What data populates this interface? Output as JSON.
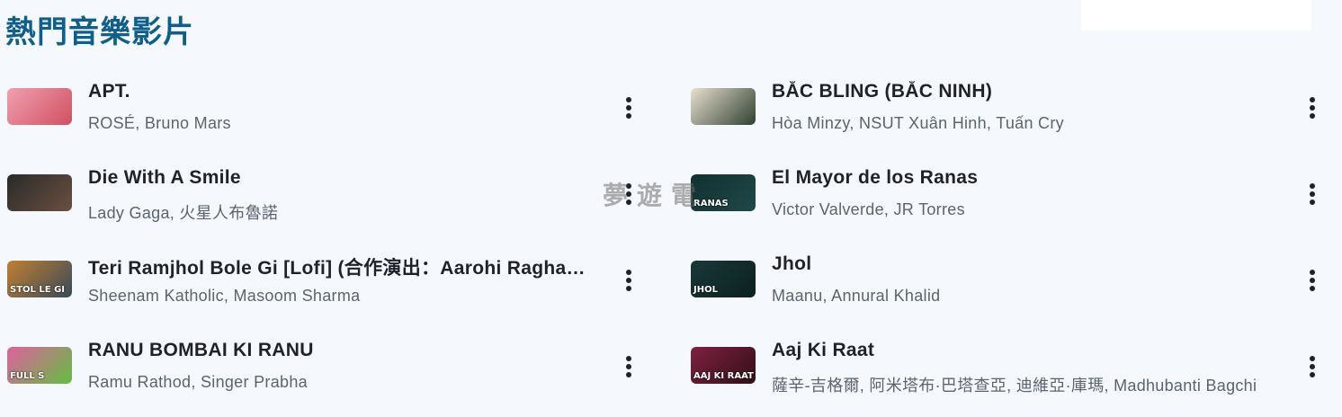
{
  "section": {
    "title": "熱門音樂影片"
  },
  "watermark": "夢遊電",
  "left_column": [
    {
      "title": "APT.",
      "artist": "ROSÉ, Bruno Mars",
      "thumb_text": "",
      "thumb_colors": [
        "#f0a0b0",
        "#d05060"
      ]
    },
    {
      "title": "Die With A Smile",
      "artist": "Lady Gaga, 火星人布魯諾",
      "thumb_text": "",
      "thumb_colors": [
        "#2a2a2a",
        "#6a5040"
      ]
    },
    {
      "title": "Teri Ramjhol Bole Gi [Lofi] (合作演出：Aarohi Raghav…",
      "artist": "Sheenam Katholic, Masoom Sharma",
      "thumb_text": "STOL LE GI",
      "thumb_colors": [
        "#c08030",
        "#3a4a5a"
      ]
    },
    {
      "title": "RANU BOMBAI KI RANU",
      "artist": "Ramu Rathod, Singer Prabha",
      "thumb_text": "FULL S",
      "thumb_colors": [
        "#e060a0",
        "#60c040"
      ]
    }
  ],
  "right_column": [
    {
      "title": "BẮC BLING (BẮC NINH)",
      "artist": "Hòa Minzy, NSUT Xuân Hinh, Tuấn Cry",
      "thumb_text": "",
      "thumb_colors": [
        "#e8e0d0",
        "#304030"
      ]
    },
    {
      "title": "El Mayor de los Ranas",
      "artist": "Victor Valverde, JR Torres",
      "thumb_text": "RANAS",
      "thumb_colors": [
        "#103030",
        "#204848"
      ]
    },
    {
      "title": "Jhol",
      "artist": "Maanu, Annural Khalid",
      "thumb_text": "JHOL",
      "thumb_colors": [
        "#1a3838",
        "#0c2020"
      ]
    },
    {
      "title": "Aaj Ki Raat",
      "artist": "薩辛-吉格爾, 阿米塔布·巴塔查亞, 迪維亞·庫瑪, Madhubanti Bagchi",
      "thumb_text": "AAJ KI RAAT",
      "thumb_colors": [
        "#802040",
        "#301018"
      ]
    }
  ]
}
